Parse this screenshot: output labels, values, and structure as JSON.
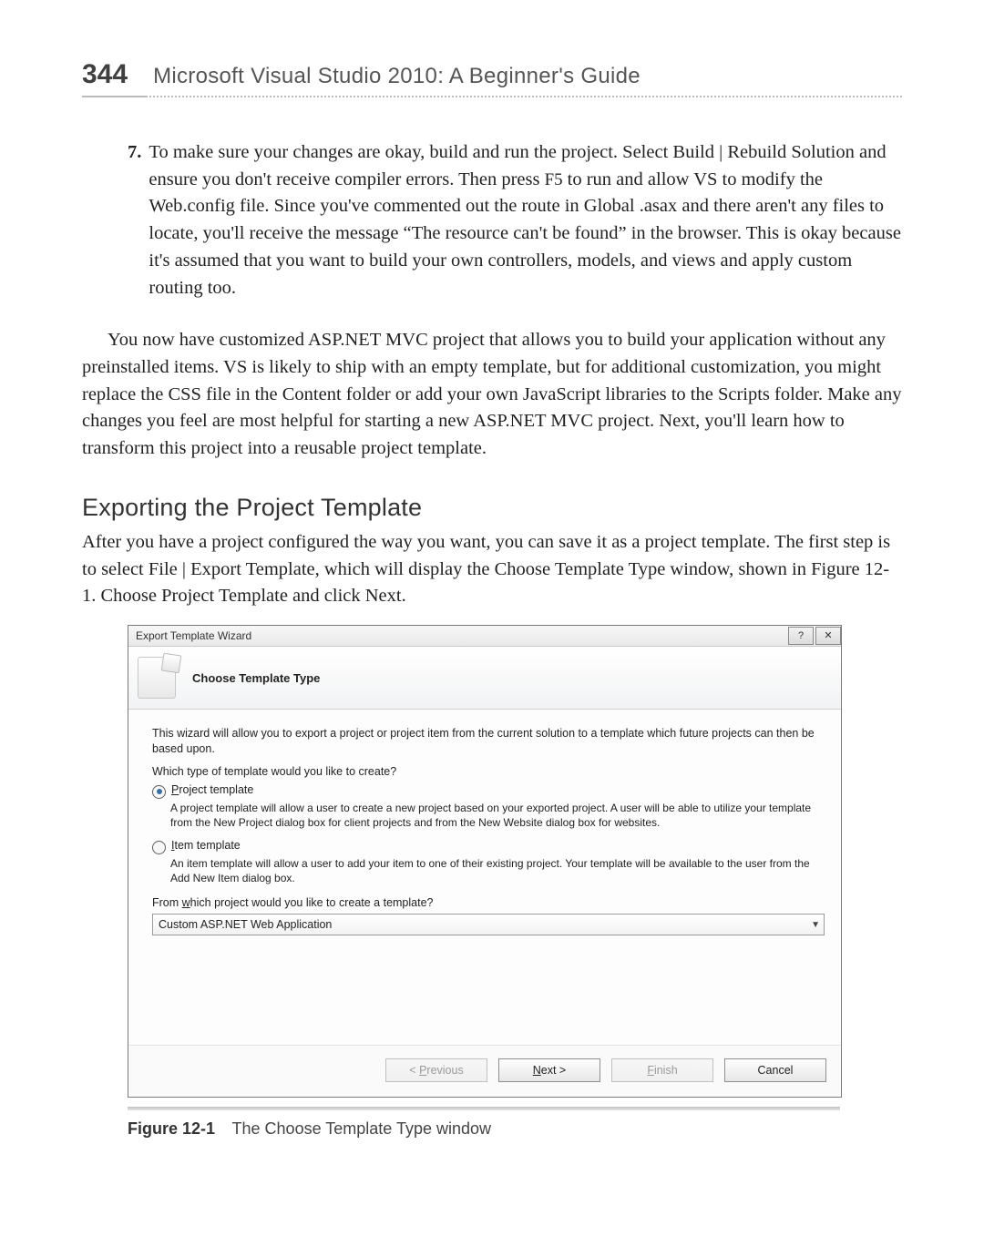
{
  "header": {
    "page_number": "344",
    "book_title": "Microsoft Visual Studio 2010: A Beginner's Guide"
  },
  "step": {
    "number": "7.",
    "text_before_key": "To make sure your changes are okay, build and run the project. Select Build | Rebuild Solution and ensure you don't receive compiler errors. Then press ",
    "key": "F5",
    "text_after_key": " to run and allow VS to modify the Web.config file. Since you've commented out the route in Global .asax and there aren't any files to locate, you'll receive the message “The resource can't be found” in the browser. This is okay because it's assumed that you want to build your own controllers, models, and views and apply custom routing too."
  },
  "para2": "You now have customized ASP.NET MVC project that allows you to build your application without any preinstalled items. VS is likely to ship with an empty template, but for additional customization, you might replace the CSS file in the Content folder or add your own JavaScript libraries to the Scripts folder. Make any changes you feel are most helpful for starting a new ASP.NET MVC project. Next, you'll learn how to transform this project into a reusable project template.",
  "section_heading": "Exporting the Project Template",
  "para3": "After you have a project configured the way you want, you can save it as a project template. The first step is to select File | Export Template, which will display the Choose Template Type window, shown in Figure 12-1. Choose Project Template and click Next.",
  "wizard": {
    "window_title": "Export Template Wizard",
    "help_glyph": "?",
    "close_glyph": "✕",
    "banner_title": "Choose Template Type",
    "intro": "This wizard will allow you to export a project or project item from the current solution to a template which future projects can then be based upon.",
    "question": "Which type of template would you like to create?",
    "option1": {
      "accel": "P",
      "rest": "roject template",
      "selected": true
    },
    "option1_desc": "A project template will allow a user to create a new project based on your exported project. A user will be able to utilize your template from the New Project dialog box for client projects and from the New Website dialog box for websites.",
    "option2": {
      "accel": "I",
      "rest": "tem template",
      "selected": false
    },
    "option2_desc": "An item template will allow a user to add your item to one of their existing project. Your template will be available to the user from the Add New Item dialog box.",
    "from_which_pre": "From ",
    "from_which_accel": "w",
    "from_which_post": "hich project would you like to create a template?",
    "dropdown_value": "Custom ASP.NET Web Application",
    "buttons": {
      "previous_pre": "< ",
      "previous_accel": "P",
      "previous_post": "revious",
      "next_accel": "N",
      "next_post": "ext >",
      "finish_accel": "F",
      "finish_post": "inish",
      "cancel": "Cancel"
    }
  },
  "figure": {
    "number": "Figure 12-1",
    "caption": "The Choose Template Type window"
  }
}
